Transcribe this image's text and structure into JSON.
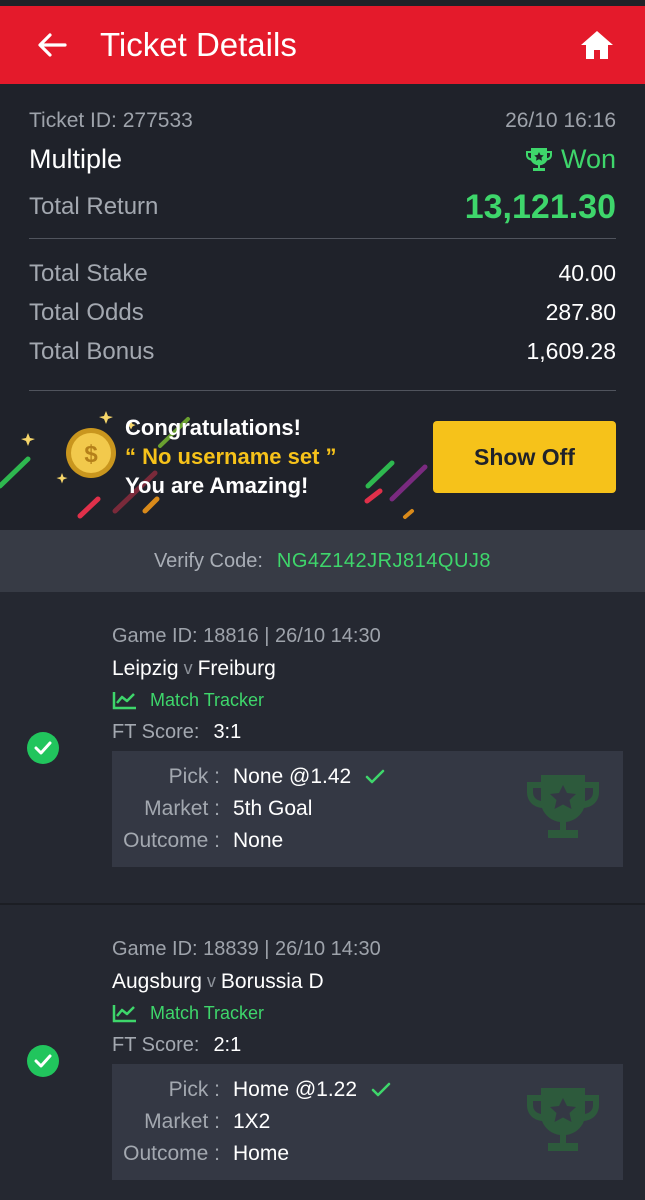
{
  "header": {
    "title": "Ticket Details"
  },
  "ticket": {
    "id_label": "Ticket ID: 277533",
    "datetime": "26/10 16:16",
    "type": "Multiple",
    "status": "Won",
    "total_return_label": "Total Return",
    "total_return": "13,121.30",
    "stats": [
      {
        "label": "Total Stake",
        "value": "40.00"
      },
      {
        "label": "Total Odds",
        "value": "287.80"
      },
      {
        "label": "Total Bonus",
        "value": "1,609.28"
      }
    ]
  },
  "promo": {
    "line1": "Congratulations!",
    "username": "“ No username set ”",
    "line3": "You are Amazing!",
    "button": "Show Off"
  },
  "verify": {
    "label": "Verify Code:",
    "code": "NG4Z142JRJ814QUJ8"
  },
  "games": [
    {
      "game_id": "Game ID: 18816 | 26/10 14:30",
      "home": "Leipzig",
      "v": "v",
      "away": "Freiburg",
      "tracker": "Match Tracker",
      "score_label": "FT Score:",
      "score": "3:1",
      "pick_label": "Pick :",
      "pick": "None @1.42",
      "market_label": "Market :",
      "market": "5th Goal",
      "outcome_label": "Outcome :",
      "outcome": "None"
    },
    {
      "game_id": "Game ID: 18839 | 26/10 14:30",
      "home": "Augsburg",
      "v": "v",
      "away": "Borussia D",
      "tracker": "Match Tracker",
      "score_label": "FT Score:",
      "score": "2:1",
      "pick_label": "Pick :",
      "pick": "Home @1.22",
      "market_label": "Market :",
      "market": "1X2",
      "outcome_label": "Outcome :",
      "outcome": "Home"
    }
  ],
  "colors": {
    "brand_red": "#e41a2b",
    "won_green": "#3ed66b",
    "button_yellow": "#f6c21a"
  }
}
